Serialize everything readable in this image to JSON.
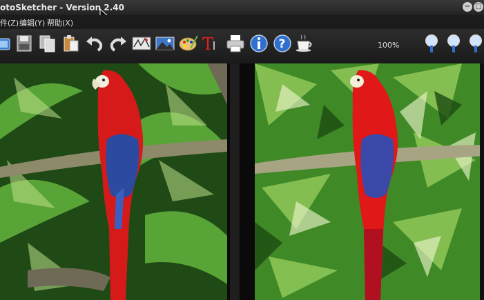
{
  "window": {
    "title": "otoSketcher - Version 2.40"
  },
  "menu": {
    "items": [
      "件(Z)",
      "编辑(Y)",
      "帮助(X)"
    ]
  },
  "toolbar": {
    "zoom": "100%"
  },
  "icons": [
    "open-icon",
    "save-icon",
    "copy-icon",
    "paste-icon",
    "undo-icon",
    "redo-icon",
    "sketch-settings-icon",
    "landscape-icon",
    "palette-icon",
    "text-icon",
    "print-icon",
    "info-icon",
    "help-icon",
    "coffee-icon",
    "zoom-in-icon",
    "zoom-fit-icon",
    "zoom-out-icon"
  ],
  "colors": {
    "title_bg": "#2a2a2a",
    "menu_bg": "#1b1b1b",
    "toolbar_bg": "#222222",
    "parrot_red": "#d61a1a",
    "jungle_green": "#3c8a2a"
  }
}
